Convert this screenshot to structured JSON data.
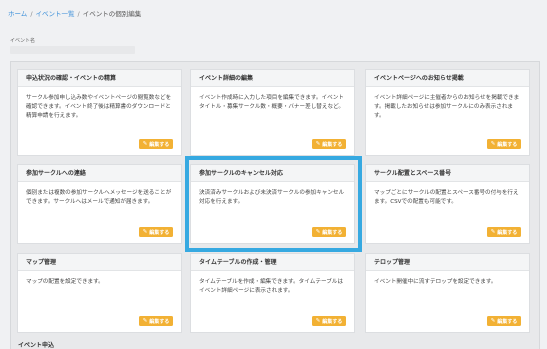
{
  "breadcrumb": {
    "home": "ホーム",
    "list": "イベント一覧",
    "current": "イベントの個別編集",
    "separator": "/"
  },
  "event_name_label": "イベント名",
  "edit_label": "編集する",
  "highlight_color": "#36a9e1",
  "button_color": "#f2b134",
  "cards": [
    {
      "title": "申込状況の確認・イベントの精算",
      "desc": "サークル参加申し込み数やイベントページの閲覧数などを確認できます。イベント終了後は精算書のダウンロードと精算申請を行えます。"
    },
    {
      "title": "イベント詳細の編集",
      "desc": "イベント作成時に入力した項目を編集できます。イベントタイトル・募集サークル数・概要・バナー差し替えなど。"
    },
    {
      "title": "イベントページへのお知らせ掲載",
      "desc": "イベント詳細ページに主催者からのお知らせを掲載できます。掲載したお知らせは参加サークルにのみ表示されます。"
    },
    {
      "title": "参加サークルへの連絡",
      "desc": "個別または複数の参加サークルへメッセージを送ることができます。サークルへはメールで通知が届きます。"
    },
    {
      "title": "参加サークルのキャンセル対応",
      "desc": "決済済みサークルおよび未決済サークルの参加キャンセル対応を行えます。"
    },
    {
      "title": "サークル配置とスペース番号",
      "desc": "マップごとにサークルの配置とスペース番号の付与を行えます。CSVでの配置も可能です。"
    },
    {
      "title": "マップ管理",
      "desc": "マップの配置を設定できます。"
    },
    {
      "title": "タイムテーブルの作成・管理",
      "desc": "タイムテーブルを作成・編集できます。タイムテーブルはイベント詳細ページに表示されます。"
    },
    {
      "title": "テロップ管理",
      "desc": "イベント開催中に流すテロップを設定できます。"
    }
  ],
  "bottom_section_title": "イベント申込"
}
